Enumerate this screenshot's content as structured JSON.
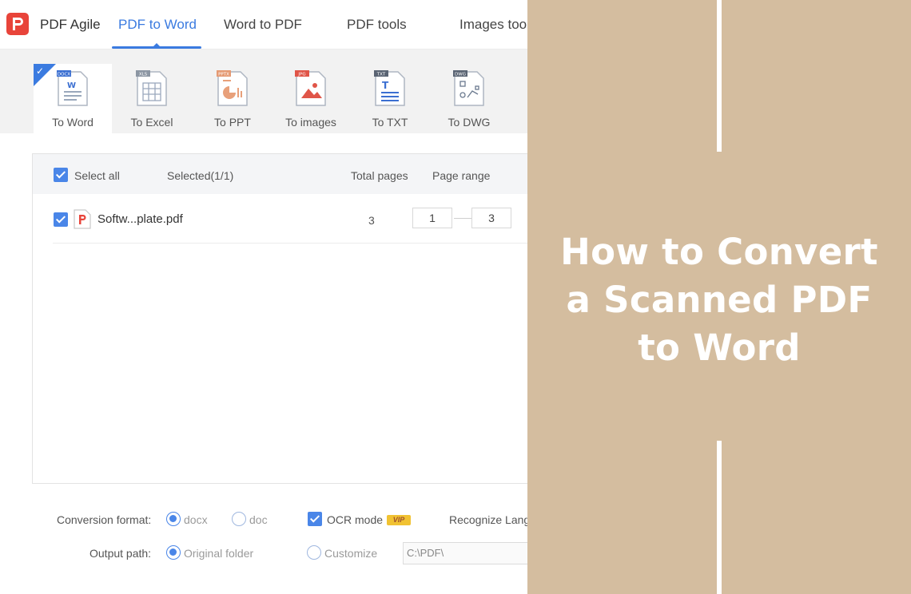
{
  "app": {
    "brand": "PDF Agile",
    "nav_tabs": [
      {
        "label": "PDF to Word",
        "active": true
      },
      {
        "label": "Word to PDF",
        "active": false
      },
      {
        "label": "PDF tools",
        "active": false
      },
      {
        "label": "Images too",
        "active": false
      }
    ],
    "tools": [
      {
        "label": "To Word",
        "badge": "DOCX",
        "icon": "docx-file-icon",
        "selected": true
      },
      {
        "label": "To Excel",
        "badge": "XLS",
        "icon": "xls-file-icon",
        "selected": false
      },
      {
        "label": "To PPT",
        "badge": "PPTX",
        "icon": "pptx-file-icon",
        "selected": false
      },
      {
        "label": "To images",
        "badge": "JPG",
        "icon": "jpg-file-icon",
        "selected": false
      },
      {
        "label": "To TXT",
        "badge": "TXT",
        "icon": "txt-file-icon",
        "selected": false
      },
      {
        "label": "To DWG",
        "badge": "DWG",
        "icon": "dwg-file-icon",
        "selected": false
      }
    ],
    "list": {
      "select_all": "Select all",
      "selected": "Selected(1/1)",
      "total_pages_header": "Total pages",
      "page_range_header": "Page range",
      "files": [
        {
          "name": "Softw...plate.pdf",
          "total_pages": "3",
          "range_from": "1",
          "range_to": "3",
          "checked": true
        }
      ]
    },
    "options": {
      "conversion_format_label": "Conversion format:",
      "format_docx": "docx",
      "format_doc": "doc",
      "format_selected": "docx",
      "ocr_mode": "OCR mode",
      "vip_badge": "VIP",
      "recognize_lang": "Recognize Lang",
      "output_path_label": "Output path:",
      "original_folder": "Original folder",
      "customize": "Customize",
      "path_value": "C:\\PDF\\"
    },
    "colors": {
      "accent": "#3b7be0",
      "logo": "#e8443a"
    }
  },
  "card": {
    "title_lines": [
      "How to Convert",
      "a Scanned PDF",
      "to Word"
    ],
    "background": "#d4bd9f"
  }
}
